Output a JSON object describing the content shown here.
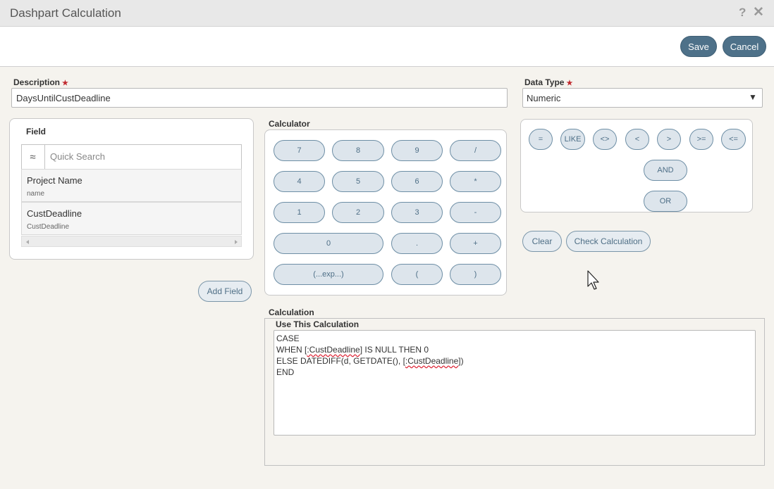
{
  "window": {
    "title": "Dashpart Calculation",
    "help_icon": "?",
    "close_icon": "✕"
  },
  "toolbar": {
    "save_label": "Save",
    "cancel_label": "Cancel"
  },
  "description": {
    "label": "Description",
    "required_mark": "★",
    "value": "DaysUntilCustDeadline"
  },
  "data_type": {
    "label": "Data Type",
    "required_mark": "★",
    "value": "Numeric",
    "arrow": "▼"
  },
  "field_panel": {
    "title": "Field",
    "search_icon": "≈",
    "search_placeholder": "Quick Search",
    "items": [
      {
        "title": "Project Name",
        "sub": "name"
      },
      {
        "title": "CustDeadline",
        "sub": "CustDeadline"
      }
    ],
    "add_field_label": "Add Field"
  },
  "calculator": {
    "title": "Calculator",
    "keys": [
      "7",
      "8",
      "9",
      "/",
      "4",
      "5",
      "6",
      "*",
      "1",
      "2",
      "3",
      "-",
      "0",
      ".",
      "+",
      "(...exp...)",
      "(",
      ")"
    ]
  },
  "operators": {
    "keys": [
      "=",
      "LIKE",
      "<>",
      "<",
      ">",
      ">=",
      "<="
    ],
    "and_label": "AND",
    "or_label": "OR"
  },
  "actions": {
    "clear_label": "Clear",
    "check_label": "Check Calculation"
  },
  "calculation": {
    "title": "Calculation",
    "subtitle": "Use This Calculation",
    "line1": "CASE",
    "line2_a": "WHEN [",
    "line2_b": ":CustDeadline",
    "line2_c": "] IS NULL THEN 0",
    "line3_a": "ELSE DATEDIFF(d, GETDATE(), [",
    "line3_b": ":CustDeadline",
    "line3_c": "])",
    "line4": "END"
  },
  "colors": {
    "accent": "#4e7189",
    "background": "#f5f3ee",
    "required": "#c0282d"
  }
}
